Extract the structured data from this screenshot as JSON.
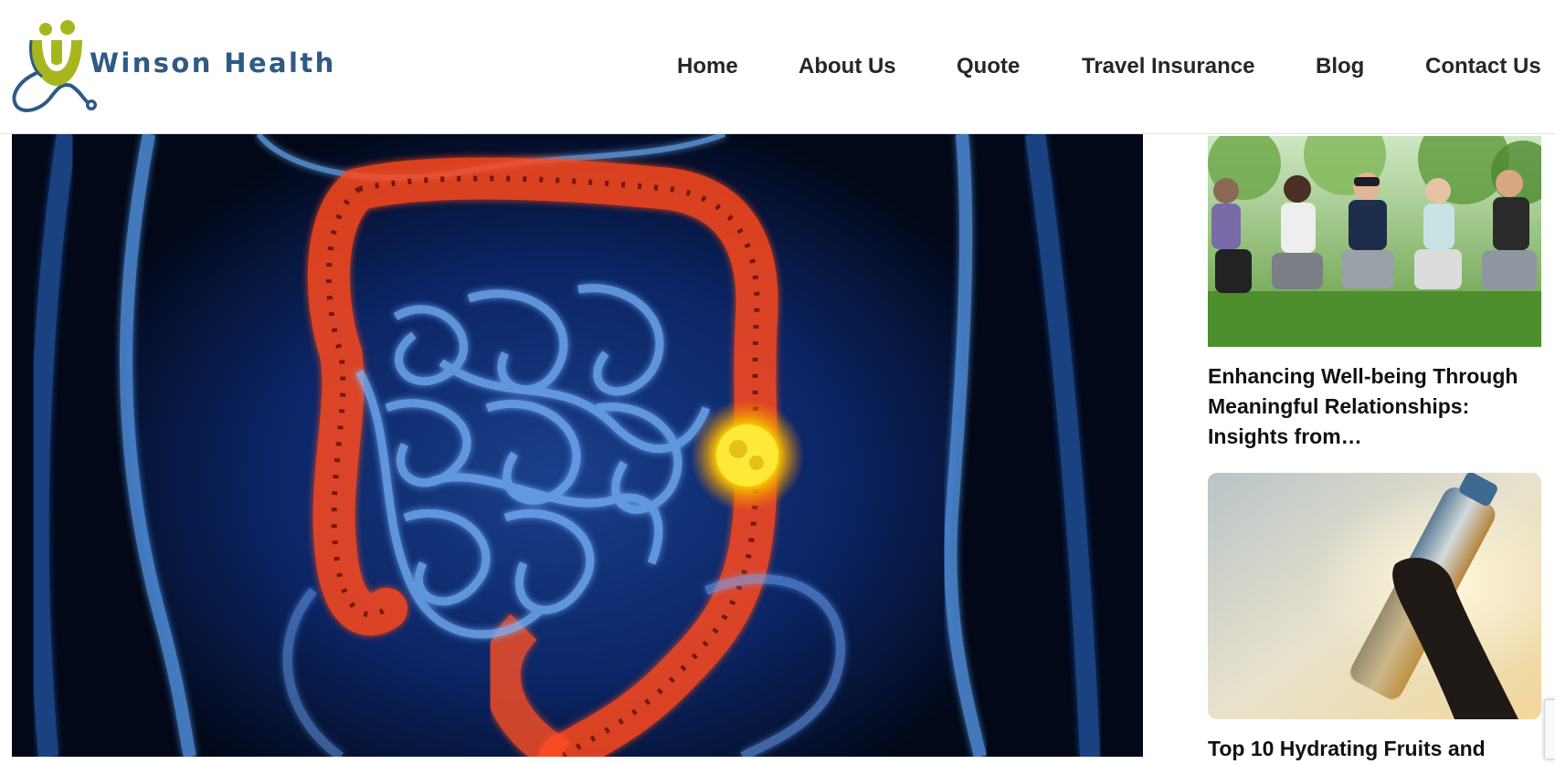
{
  "site": {
    "brand_name": "Winson Health",
    "colors": {
      "brand_blue": "#2f5a86",
      "brand_lime": "#a8b61e",
      "nav_text": "#262626",
      "title_text": "#111111"
    }
  },
  "nav": {
    "items": [
      {
        "label": "Home"
      },
      {
        "label": "About Us"
      },
      {
        "label": "Quote"
      },
      {
        "label": "Travel Insurance"
      },
      {
        "label": "Blog"
      },
      {
        "label": "Contact Us"
      }
    ]
  },
  "sidebar": {
    "cards": [
      {
        "title": "Enhancing Well-being Through Meaningful Relationships: Insights from…",
        "image": "group-of-seniors-sitting-on-grass"
      },
      {
        "title": "Top 10 Hydrating Fruits and",
        "image": "hand-holding-water-bottle-at-sunset"
      }
    ]
  },
  "hero": {
    "image": "glowing-human-intestines-with-colon-tumor-xray"
  }
}
